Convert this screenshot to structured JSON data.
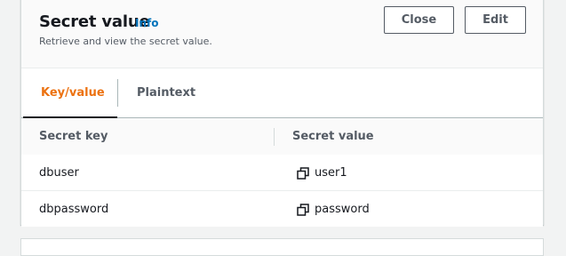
{
  "header": {
    "title": "Secret value",
    "info": "Info",
    "subtitle": "Retrieve and view the secret value.",
    "close_label": "Close",
    "edit_label": "Edit"
  },
  "tabs": [
    {
      "label": "Key/value",
      "active": true
    },
    {
      "label": "Plaintext",
      "active": false
    }
  ],
  "table": {
    "columns": [
      "Secret key",
      "Secret value"
    ],
    "rows": [
      {
        "key": "dbuser",
        "value": "user1"
      },
      {
        "key": "dbpassword",
        "value": "password"
      }
    ]
  },
  "icons": {
    "copy": "copy-icon"
  },
  "colors": {
    "accent": "#ec7211",
    "link": "#0073bb",
    "text": "#16191f",
    "muted": "#545b64"
  }
}
